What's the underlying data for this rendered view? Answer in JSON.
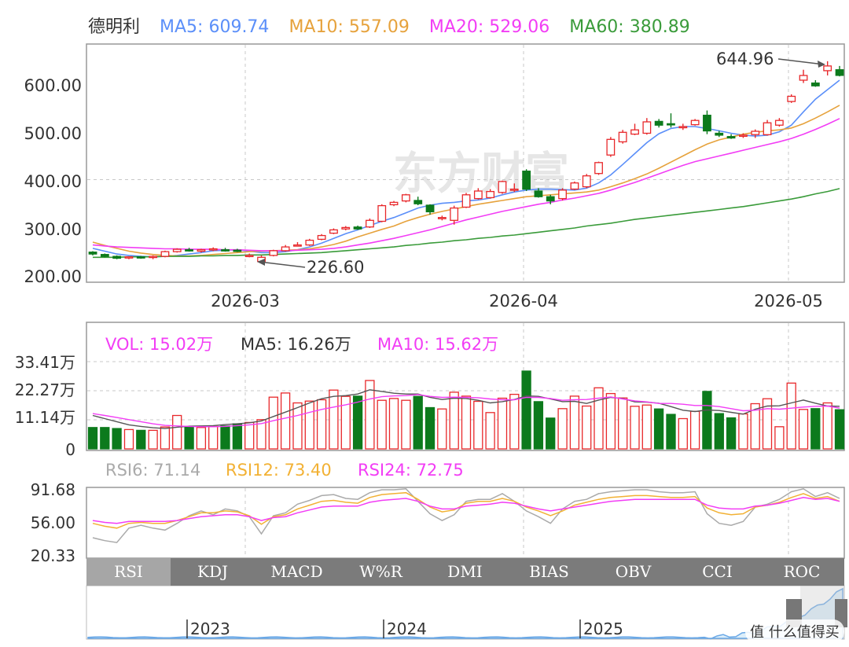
{
  "colors": {
    "up": "#e8282b",
    "down": "#0c7a1c",
    "ma5": "#5b8ff9",
    "ma10": "#e6a23c",
    "ma20": "#f23df5",
    "ma60": "#3a9b3a",
    "vol_ma5": "#555555",
    "vol_ma10": "#f23df5",
    "rsi6": "#aaaaaa",
    "rsi12": "#f2b134",
    "rsi24": "#f23df5",
    "tab_bg": "#7b7b7b",
    "tab_active_bg": "#a6a6a6",
    "grid": "#c8c8c8",
    "nav_line": "#6aa8e6"
  },
  "header": {
    "stock_name": "德明利",
    "ma5": "MA5: 609.74",
    "ma10": "MA10: 557.09",
    "ma20": "MA20: 529.06",
    "ma60": "MA60: 380.89"
  },
  "price_axis": [
    "600.00",
    "500.00",
    "400.00",
    "300.00",
    "200.00"
  ],
  "date_axis": [
    "2026-03",
    "2026-04",
    "2026-05"
  ],
  "annotations": {
    "high": "644.96",
    "low": "226.60"
  },
  "watermark": "东方财富",
  "volume_legend": {
    "vol": "VOL: 15.02万",
    "ma5": "MA5: 16.26万",
    "ma10": "MA10: 15.62万"
  },
  "volume_axis": [
    "33.41万",
    "22.27万",
    "11.14万",
    "0"
  ],
  "rsi_legend": {
    "rsi6": "RSI6: 71.14",
    "rsi12": "RSI12: 73.40",
    "rsi24": "RSI24: 72.75"
  },
  "rsi_axis": [
    "91.68",
    "56.00",
    "20.33"
  ],
  "tabs": [
    "RSI",
    "KDJ",
    "MACD",
    "W%R",
    "DMI",
    "BIAS",
    "OBV",
    "CCI",
    "ROC"
  ],
  "active_tab": "RSI",
  "navigator_years": [
    "2023",
    "2024",
    "2025"
  ],
  "footer_badge": "值 什么值得买",
  "chart_data": [
    {
      "type": "candlestick",
      "title": "德明利",
      "x_labels": [
        "2026-03",
        "2026-04",
        "2026-05"
      ],
      "ylim": [
        200,
        665
      ],
      "y_ticks": [
        600,
        500,
        400,
        300,
        200
      ],
      "candles": [
        [
          247,
          249,
          240,
          243
        ],
        [
          242,
          244,
          236,
          238
        ],
        [
          238,
          240,
          232,
          234
        ],
        [
          236,
          238,
          232,
          237
        ],
        [
          237,
          239,
          233,
          236
        ],
        [
          236,
          240,
          232,
          238
        ],
        [
          238,
          250,
          236,
          248
        ],
        [
          248,
          255,
          246,
          253
        ],
        [
          252,
          256,
          248,
          250
        ],
        [
          249,
          254,
          246,
          252
        ],
        [
          252,
          257,
          249,
          254
        ],
        [
          252,
          256,
          248,
          251
        ],
        [
          251,
          254,
          247,
          249
        ],
        [
          240,
          244,
          236,
          240
        ],
        [
          227,
          240,
          225,
          236
        ],
        [
          240,
          252,
          238,
          250
        ],
        [
          250,
          262,
          248,
          258
        ],
        [
          262,
          268,
          260,
          262
        ],
        [
          262,
          275,
          260,
          272
        ],
        [
          274,
          285,
          272,
          282
        ],
        [
          287,
          297,
          285,
          294
        ],
        [
          296,
          302,
          293,
          299
        ],
        [
          300,
          303,
          294,
          296
        ],
        [
          300,
          318,
          298,
          314
        ],
        [
          312,
          348,
          310,
          345
        ],
        [
          347,
          355,
          344,
          352
        ],
        [
          355,
          370,
          352,
          368
        ],
        [
          356,
          364,
          346,
          349
        ],
        [
          346,
          348,
          326,
          332
        ],
        [
          318,
          324,
          314,
          320
        ],
        [
          314,
          345,
          305,
          340
        ],
        [
          342,
          372,
          340,
          368
        ],
        [
          360,
          382,
          358,
          376
        ],
        [
          362,
          380,
          360,
          375
        ],
        [
          373,
          398,
          370,
          396
        ],
        [
          378,
          392,
          374,
          380
        ],
        [
          418,
          422,
          376,
          380
        ],
        [
          376,
          382,
          362,
          364
        ],
        [
          364,
          368,
          348,
          355
        ],
        [
          360,
          382,
          356,
          378
        ],
        [
          380,
          396,
          378,
          393
        ],
        [
          385,
          412,
          382,
          408
        ],
        [
          413,
          438,
          410,
          436
        ],
        [
          452,
          490,
          448,
          485
        ],
        [
          480,
          505,
          476,
          500
        ],
        [
          496,
          518,
          494,
          505
        ],
        [
          498,
          530,
          495,
          522
        ],
        [
          523,
          528,
          510,
          515
        ],
        [
          518,
          540,
          510,
          516
        ],
        [
          510,
          518,
          505,
          512
        ],
        [
          516,
          528,
          514,
          525
        ],
        [
          536,
          546,
          496,
          503
        ],
        [
          498,
          503,
          490,
          494
        ],
        [
          491,
          496,
          486,
          488
        ],
        [
          492,
          498,
          488,
          494
        ],
        [
          495,
          506,
          488,
          502
        ],
        [
          495,
          526,
          493,
          520
        ],
        [
          515,
          530,
          512,
          525
        ],
        [
          565,
          580,
          562,
          576
        ],
        [
          610,
          632,
          604,
          620
        ],
        [
          604,
          610,
          596,
          598
        ],
        [
          630,
          650,
          620,
          640
        ],
        [
          632,
          640,
          618,
          620
        ]
      ],
      "series": [
        {
          "name": "MA5",
          "values": [
            255,
            249,
            243,
            240,
            238,
            237,
            238,
            240,
            243,
            246,
            250,
            251,
            252,
            249,
            246,
            246,
            248,
            252,
            258,
            266,
            276,
            286,
            294,
            303,
            312,
            320,
            330,
            340,
            346,
            350,
            352,
            355,
            357,
            361,
            368,
            374,
            378,
            380,
            380,
            379,
            378,
            382,
            393,
            410,
            432,
            455,
            478,
            497,
            508,
            512,
            512,
            508,
            503,
            498,
            494,
            492,
            494,
            501,
            515,
            543,
            570,
            590,
            610
          ]
        },
        {
          "name": "MA10",
          "values": [
            268,
            261,
            255,
            249,
            245,
            242,
            240,
            239,
            239,
            240,
            242,
            244,
            246,
            248,
            249,
            250,
            251,
            252,
            254,
            258,
            263,
            270,
            279,
            287,
            295,
            302,
            312,
            320,
            327,
            333,
            338,
            343,
            348,
            352,
            356,
            360,
            364,
            366,
            368,
            370,
            372,
            374,
            378,
            385,
            393,
            402,
            412,
            424,
            437,
            450,
            463,
            475,
            484,
            490,
            496,
            500,
            503,
            505,
            509,
            518,
            530,
            543,
            557
          ]
        },
        {
          "name": "MA20",
          "values": [
            262,
            260,
            258,
            257,
            256,
            255,
            254,
            254,
            253,
            253,
            253,
            252,
            252,
            251,
            250,
            250,
            250,
            251,
            252,
            253,
            255,
            258,
            262,
            266,
            271,
            276,
            282,
            288,
            294,
            301,
            308,
            315,
            321,
            327,
            333,
            338,
            343,
            348,
            352,
            357,
            361,
            366,
            371,
            378,
            386,
            394,
            403,
            412,
            421,
            430,
            438,
            444,
            450,
            456,
            462,
            468,
            474,
            480,
            487,
            496,
            506,
            517,
            529
          ]
        },
        {
          "name": "MA60",
          "values": [
            236,
            236,
            236,
            237,
            237,
            237,
            238,
            238,
            238,
            239,
            239,
            240,
            240,
            241,
            241,
            242,
            243,
            244,
            245,
            246,
            248,
            250,
            252,
            254,
            256,
            258,
            261,
            263,
            266,
            268,
            271,
            273,
            276,
            278,
            281,
            283,
            286,
            289,
            292,
            295,
            298,
            302,
            305,
            308,
            312,
            316,
            319,
            322,
            325,
            328,
            331,
            334,
            337,
            340,
            343,
            347,
            351,
            355,
            359,
            364,
            370,
            375,
            381
          ]
        }
      ]
    },
    {
      "type": "bar",
      "title": "VOL",
      "unit": "万",
      "ylim": [
        0,
        33.41
      ],
      "y_ticks": [
        0,
        11.14,
        22.27,
        33.41
      ],
      "values": [
        8.2,
        8.2,
        7.8,
        7.4,
        7.1,
        7.1,
        8.4,
        12.8,
        8.3,
        8.2,
        8.6,
        8.8,
        9.6,
        10.1,
        11.2,
        19.8,
        21.4,
        17.6,
        18.3,
        18.8,
        22.5,
        20.1,
        20.2,
        26.2,
        18.6,
        19.3,
        18.6,
        20.1,
        15.8,
        15.3,
        21.7,
        20.2,
        18.2,
        13.9,
        19.4,
        20.9,
        29.8,
        18.1,
        11.8,
        15.4,
        20.2,
        16.4,
        23.4,
        21.2,
        19.5,
        16.3,
        16.8,
        15.3,
        13.2,
        11.6,
        14.4,
        22.0,
        13.5,
        11.9,
        13.4,
        17.3,
        19.2,
        8.5,
        25.2,
        15.1,
        15.4,
        17.6,
        15.0
      ],
      "series": [
        {
          "name": "MA5",
          "values": [
            12.8,
            11.6,
            10.4,
            9.2,
            8.6,
            8.1,
            7.8,
            8.3,
            8.7,
            8.8,
            8.9,
            9.3,
            9.6,
            10.0,
            10.7,
            12.4,
            14.1,
            15.8,
            17.6,
            19.2,
            20.1,
            20.4,
            21.0,
            22.6,
            22.0,
            21.3,
            21.0,
            21.0,
            19.7,
            18.9,
            19.4,
            19.3,
            18.6,
            17.6,
            18.1,
            18.9,
            20.3,
            20.1,
            19.1,
            18.1,
            18.2,
            17.4,
            18.7,
            19.7,
            19.3,
            18.0,
            17.9,
            17.5,
            16.2,
            14.8,
            14.3,
            14.9,
            14.7,
            14.0,
            13.3,
            15.2,
            16.4,
            16.5,
            17.6,
            18.7,
            17.5,
            16.4,
            16.3
          ]
        },
        {
          "name": "MA10",
          "values": [
            13.5,
            12.8,
            12.0,
            11.2,
            10.4,
            9.6,
            9.0,
            8.8,
            8.6,
            8.5,
            8.5,
            8.6,
            8.9,
            9.2,
            9.7,
            10.8,
            11.8,
            12.8,
            14.0,
            15.1,
            16.0,
            16.9,
            17.9,
            19.1,
            20.0,
            20.3,
            20.4,
            20.8,
            20.1,
            19.7,
            19.8,
            19.7,
            19.6,
            19.1,
            18.8,
            18.8,
            19.7,
            19.7,
            19.3,
            18.6,
            18.8,
            18.9,
            19.4,
            19.9,
            19.1,
            18.4,
            18.0,
            17.4,
            17.4,
            17.1,
            16.6,
            16.6,
            16.2,
            15.4,
            14.6,
            14.8,
            15.4,
            15.2,
            15.6,
            16.0,
            16.3,
            16.4,
            15.6
          ]
        }
      ]
    },
    {
      "type": "line",
      "title": "RSI",
      "ylim": [
        20.33,
        91.68
      ],
      "y_ticks": [
        20.33,
        56.0,
        91.68
      ],
      "series": [
        {
          "name": "RSI6",
          "values": [
            40,
            37,
            35,
            50,
            53,
            50,
            48,
            55,
            63,
            68,
            64,
            70,
            68,
            62,
            44,
            63,
            66,
            75,
            79,
            84,
            85,
            81,
            80,
            87,
            90,
            90,
            91,
            78,
            65,
            58,
            64,
            78,
            80,
            80,
            86,
            78,
            68,
            62,
            55,
            70,
            78,
            80,
            86,
            88,
            89,
            90,
            90,
            88,
            87,
            87,
            88,
            65,
            55,
            53,
            57,
            72,
            75,
            80,
            88,
            91,
            83,
            87,
            81
          ]
        },
        {
          "name": "RSI12",
          "values": [
            55,
            52,
            50,
            55,
            56,
            55,
            55,
            58,
            62,
            66,
            66,
            68,
            67,
            63,
            54,
            62,
            64,
            70,
            74,
            78,
            79,
            77,
            76,
            82,
            85,
            86,
            87,
            80,
            72,
            67,
            69,
            76,
            78,
            78,
            81,
            78,
            72,
            68,
            63,
            68,
            74,
            77,
            80,
            82,
            83,
            84,
            84,
            83,
            82,
            82,
            83,
            71,
            66,
            64,
            65,
            72,
            74,
            77,
            82,
            86,
            81,
            83,
            78
          ]
        },
        {
          "name": "RSI24",
          "values": [
            58,
            56,
            55,
            57,
            57,
            57,
            57,
            58,
            60,
            62,
            63,
            64,
            64,
            62,
            58,
            61,
            62,
            66,
            69,
            72,
            73,
            73,
            73,
            77,
            79,
            80,
            81,
            78,
            73,
            70,
            70,
            73,
            74,
            75,
            77,
            76,
            73,
            70,
            68,
            70,
            72,
            74,
            76,
            78,
            79,
            80,
            80,
            80,
            80,
            80,
            80,
            74,
            71,
            70,
            70,
            73,
            74,
            76,
            79,
            82,
            80,
            81,
            78
          ]
        }
      ]
    }
  ]
}
